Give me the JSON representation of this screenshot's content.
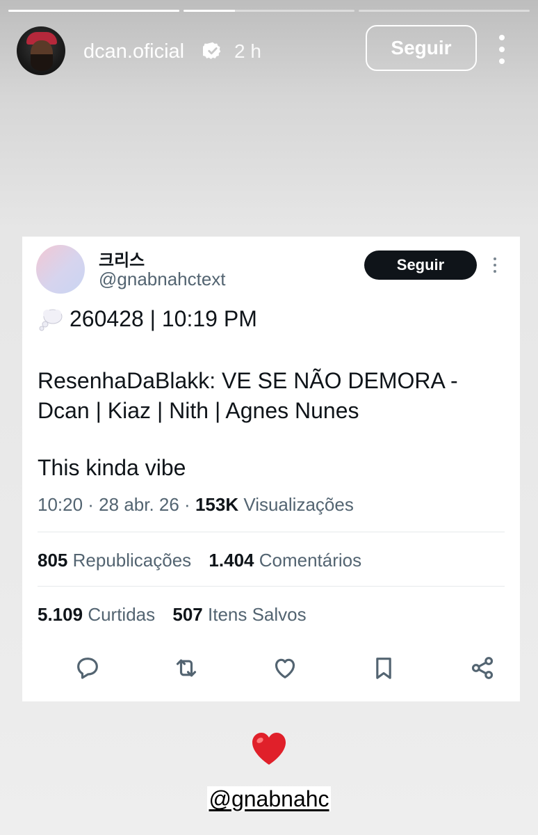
{
  "story": {
    "progress": [
      {
        "fill": 1.0
      },
      {
        "fill": 0.3
      },
      {
        "fill": 0.0
      }
    ],
    "username": "dcan.oficial",
    "time": "2 h",
    "follow_label": "Seguir",
    "mention": "@gnabnahc",
    "sticker_icon": "red-heart-emoji"
  },
  "tweet": {
    "display_name": "크리스",
    "handle": "@gnabnahctext",
    "follow_label": "Seguir",
    "line1_icon": "thought-bubble-emoji",
    "line1": "260428 | 10:19 PM",
    "body": "ResenhaDaBlakk: VE SE NÃO DEMORA - Dcan | Kiaz | Nith | Agnes Nunes",
    "body2": "This kinda vibe",
    "meta": {
      "time": "10:20 · 28 abr. 26 · ",
      "views_count": "153K",
      "views_label": " Visualizações"
    },
    "stats_row1": [
      {
        "count": "805",
        "label": "Republicações"
      },
      {
        "count": "1.404",
        "label": "Comentários"
      }
    ],
    "stats_row2": [
      {
        "count": "5.109",
        "label": "Curtidas"
      },
      {
        "count": "507",
        "label": "Itens Salvos"
      }
    ],
    "actions": [
      "reply-icon",
      "retweet-icon",
      "like-icon",
      "bookmark-icon",
      "share-icon"
    ]
  },
  "colors": {
    "tweet_text": "#0f1419",
    "tweet_secondary": "#536471",
    "follow_button_bg": "#0f1419"
  }
}
